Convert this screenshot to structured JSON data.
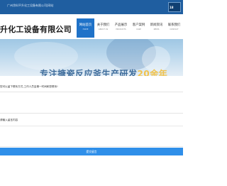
{
  "topbar": {
    "text": "广州涂料平升化工设备有限公司|网站",
    "logo": "18"
  },
  "header": {
    "company_name": "升化工设备有限公司"
  },
  "nav": {
    "items": [
      {
        "label": "网站首页",
        "sub": "HOME",
        "active": true
      },
      {
        "label": "关于我们",
        "sub": "ABOUT US",
        "active": false
      },
      {
        "label": "产品展示",
        "sub": "PRODUCTS",
        "active": false
      },
      {
        "label": "客户案例",
        "sub": "CASE",
        "active": false
      },
      {
        "label": "新闻资讯",
        "sub": "NEWS",
        "active": false
      },
      {
        "label": "联系我们",
        "sub": "CONTACT",
        "active": false
      }
    ]
  },
  "banner": {
    "text_main": "专注搪瓷反应釜生产研发",
    "text_highlight": "20余年"
  },
  "form": {
    "prompt": "您可以留下联系方式,工作人员会第一时间和您联系!",
    "field_label": "请输入留言内容",
    "submit_label": "提交留言"
  },
  "colors": {
    "accent": "#1f72c8",
    "submit": "#2f8fe9",
    "topbar": "#1f5ea0"
  }
}
